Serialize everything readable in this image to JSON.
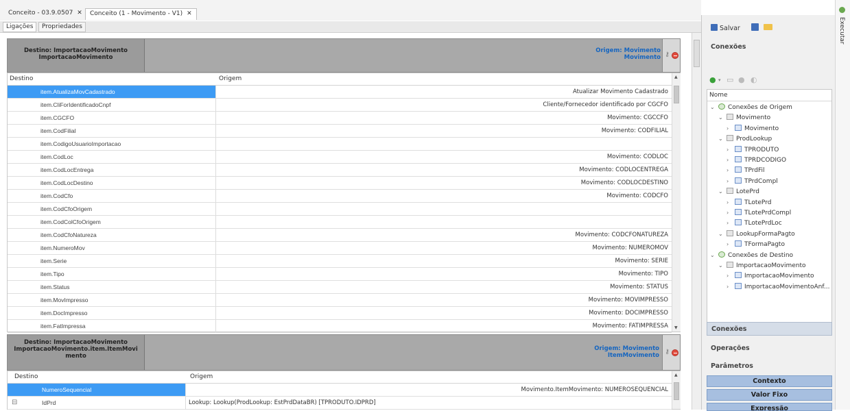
{
  "doc_tabs": [
    {
      "label": "Conceito - 03.9.0507",
      "close": "✕"
    },
    {
      "label": "Conceito (1 - Movimento - V1)",
      "close": "✕"
    }
  ],
  "sub_tabs": [
    "Ligações",
    "Propriedades"
  ],
  "panel1": {
    "destino_line1": "Destino: ImportacaoMovimento",
    "destino_line2": "ImportacaoMovimento",
    "origem_line1": "Origem: Movimento",
    "origem_line2": "Movimento",
    "col_destino": "Destino",
    "col_origem": "Origem",
    "rows": [
      {
        "destino": "item.AtualizaMovCadastrado",
        "origem": "Atualizar Movimento Cadastrado"
      },
      {
        "destino": "item.CliForIdentificadoCnpf",
        "origem": "Cliente/Fornecedor identificado por CGCFO"
      },
      {
        "destino": "item.CGCFO",
        "origem": "Movimento: CGCCFO"
      },
      {
        "destino": "item.CodFilial",
        "origem": "Movimento: CODFILIAL"
      },
      {
        "destino": "item.CodigoUsuarioImportacao",
        "origem": ""
      },
      {
        "destino": "item.CodLoc",
        "origem": "Movimento: CODLOC"
      },
      {
        "destino": "item.CodLocEntrega",
        "origem": "Movimento: CODLOCENTREGA"
      },
      {
        "destino": "item.CodLocDestino",
        "origem": "Movimento: CODLOCDESTINO"
      },
      {
        "destino": "item.CodCfo",
        "origem": "Movimento: CODCFO"
      },
      {
        "destino": "item.CodCfoOrigem",
        "origem": ""
      },
      {
        "destino": "item.CodColCfoOrigem",
        "origem": ""
      },
      {
        "destino": "item.CodCfoNatureza",
        "origem": "Movimento: CODCFONATUREZA"
      },
      {
        "destino": "item.NumeroMov",
        "origem": "Movimento: NUMEROMOV"
      },
      {
        "destino": "item.Serie",
        "origem": "Movimento: SERIE"
      },
      {
        "destino": "item.Tipo",
        "origem": "Movimento: TIPO"
      },
      {
        "destino": "item.Status",
        "origem": "Movimento: STATUS"
      },
      {
        "destino": "item.MovImpresso",
        "origem": "Movimento: MOVIMPRESSO"
      },
      {
        "destino": "item.DocImpresso",
        "origem": "Movimento: DOCIMPRESSO"
      },
      {
        "destino": "item.FatImpressa",
        "origem": "Movimento: FATIMPRESSA"
      }
    ]
  },
  "panel2": {
    "destino_line1": "Destino: ImportacaoMovimento",
    "destino_line2": "ImportacaoMovimento.item.ItemMovi",
    "destino_line3": "mento",
    "origem_line1": "Origem: Movimento",
    "origem_line2": "ItemMovimento",
    "col_destino": "Destino",
    "col_origem": "Origem",
    "rows": [
      {
        "expander": "",
        "destino": "NumeroSequencial",
        "origem": "Movimento.ItemMovimento: NUMEROSEQUENCIAL"
      },
      {
        "expander": "⊟",
        "destino": "IdPrd",
        "origem": "Lookup: Lookup(ProdLookup: EstPrdDataBR) [TPRODUTO.IDPRD]"
      }
    ]
  },
  "right": {
    "save_label": "Salvar",
    "conexoes_title": "Conexões",
    "tree_header": "Nome",
    "tree": [
      {
        "level": 0,
        "expander": "⌄",
        "icon": "src",
        "label": "Conexões de Origem"
      },
      {
        "level": 1,
        "expander": "⌄",
        "icon": "db",
        "label": "Movimento"
      },
      {
        "level": 2,
        "expander": "›",
        "icon": "tbl",
        "label": "Movimento"
      },
      {
        "level": 1,
        "expander": "⌄",
        "icon": "db",
        "label": "ProdLookup"
      },
      {
        "level": 2,
        "expander": "›",
        "icon": "tbl",
        "label": "TPRODUTO"
      },
      {
        "level": 2,
        "expander": "›",
        "icon": "tbl",
        "label": "TPRDCODIGO"
      },
      {
        "level": 2,
        "expander": "›",
        "icon": "tbl",
        "label": "TPrdFil"
      },
      {
        "level": 2,
        "expander": "›",
        "icon": "tbl",
        "label": "TPrdCompl"
      },
      {
        "level": 1,
        "expander": "⌄",
        "icon": "db",
        "label": "LotePrd"
      },
      {
        "level": 2,
        "expander": "›",
        "icon": "tbl",
        "label": "TLotePrd"
      },
      {
        "level": 2,
        "expander": "›",
        "icon": "tbl",
        "label": "TLotePrdCompl"
      },
      {
        "level": 2,
        "expander": "›",
        "icon": "tbl",
        "label": "TLotePrdLoc"
      },
      {
        "level": 1,
        "expander": "⌄",
        "icon": "db",
        "label": "LookupFormaPagto"
      },
      {
        "level": 2,
        "expander": "›",
        "icon": "tbl",
        "label": "TFormaPagto"
      },
      {
        "level": 0,
        "expander": "⌄",
        "icon": "src",
        "label": "Conexões de Destino"
      },
      {
        "level": 1,
        "expander": "⌄",
        "icon": "db",
        "label": "ImportacaoMovimento"
      },
      {
        "level": 2,
        "expander": "›",
        "icon": "tbl",
        "label": "ImportacaoMovimento"
      },
      {
        "level": 2,
        "expander": "›",
        "icon": "tbl",
        "label": "ImportacaoMovimentoAnf..."
      }
    ],
    "nav_buttons": [
      "Conexões",
      "Operações",
      "Parâmetros"
    ],
    "blue_buttons": [
      "Contexto",
      "Valor Fixo",
      "Expressão"
    ]
  },
  "side_strip_label": "Executar"
}
